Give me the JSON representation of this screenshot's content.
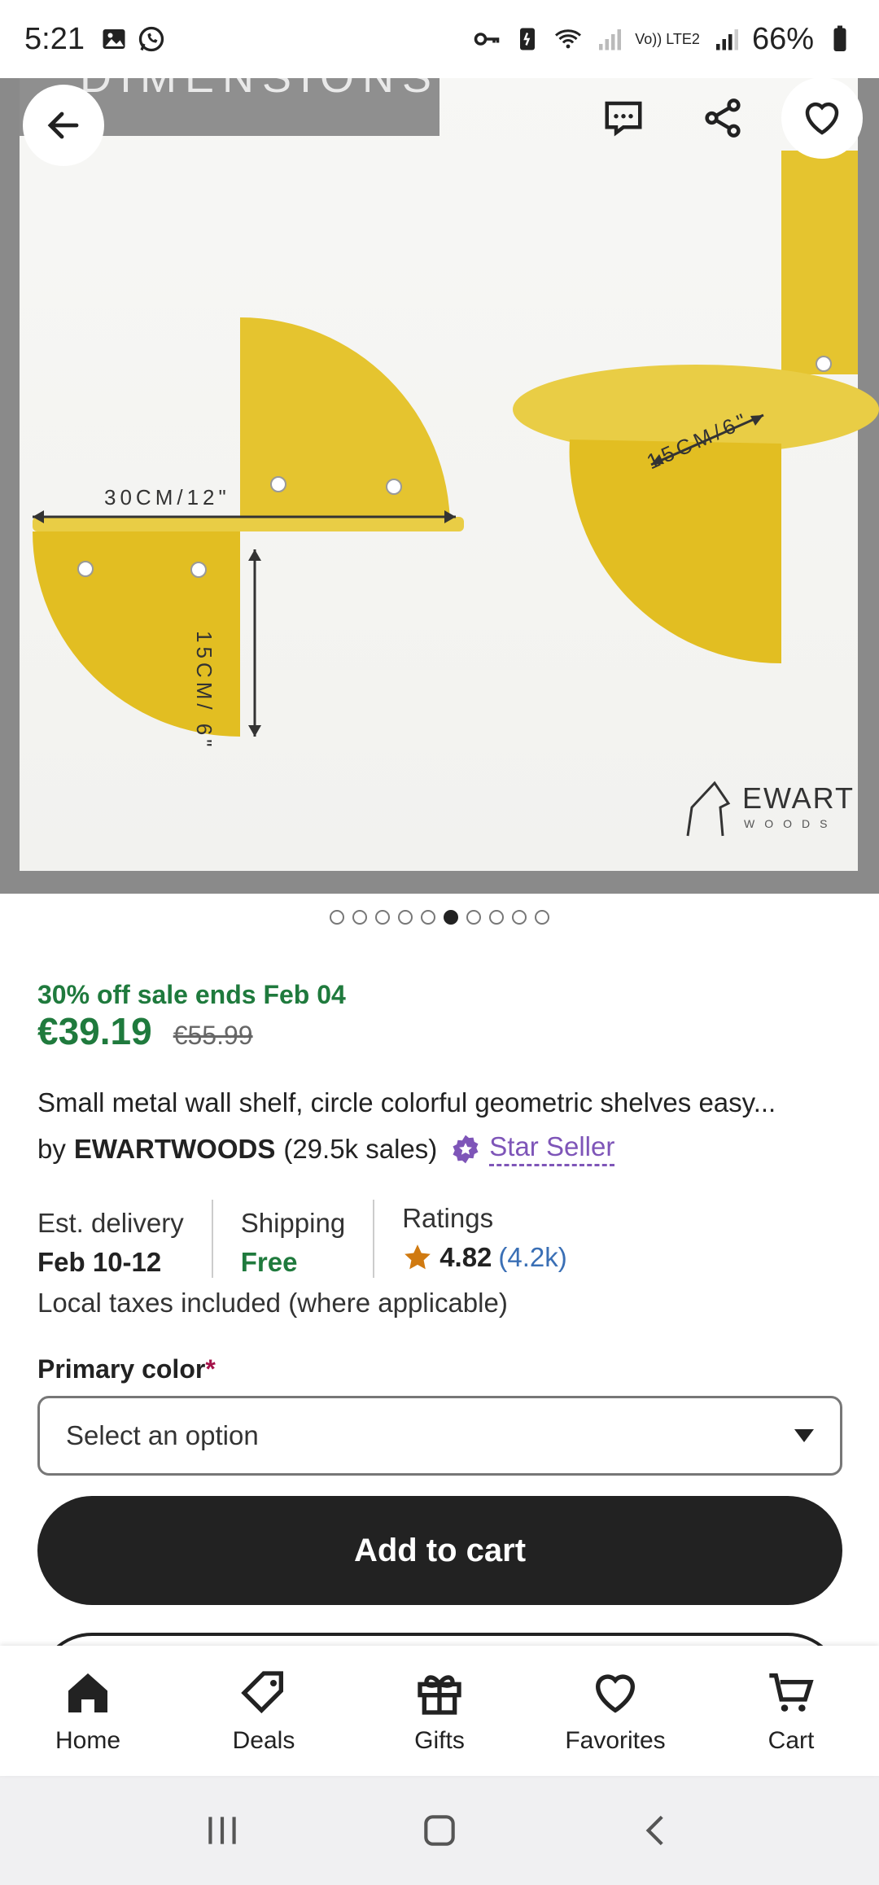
{
  "status_bar": {
    "time": "5:21",
    "battery": "66%",
    "network": "Vo)) LTE2"
  },
  "product_image": {
    "banner_text": "DIMENSIONS",
    "dim_width": "30CM/12\"",
    "dim_height": "15CM/ 6\"",
    "dim_depth": "15CM/6\"",
    "brand_logo": "EWART",
    "brand_sub": "WOODS",
    "carousel": {
      "count": 10,
      "active_index": 5
    }
  },
  "sale": {
    "text": "30% off sale ends Feb 04",
    "price": "€39.19",
    "original_price": "€55.99"
  },
  "product": {
    "title": "Small metal wall shelf, circle colorful geometric shelves easy...",
    "by": "by",
    "shop": "EWARTWOODS",
    "sales": "(29.5k sales)",
    "badge": "Star Seller"
  },
  "info": {
    "delivery_label": "Est. delivery",
    "delivery_value": "Feb 10-12",
    "shipping_label": "Shipping",
    "shipping_value": "Free",
    "ratings_label": "Ratings",
    "rating_value": "4.82",
    "rating_count": "(4.2k)",
    "taxes": "Local taxes included (where applicable)"
  },
  "options": {
    "label": "Primary color",
    "required_mark": "*",
    "select_value": "Select an option"
  },
  "actions": {
    "add_to_cart": "Add to cart"
  },
  "bottom_nav": [
    {
      "label": "Home",
      "icon": "home-icon"
    },
    {
      "label": "Deals",
      "icon": "tag-icon"
    },
    {
      "label": "Gifts",
      "icon": "gift-icon"
    },
    {
      "label": "Favorites",
      "icon": "heart-icon"
    },
    {
      "label": "Cart",
      "icon": "cart-icon"
    }
  ],
  "colors": {
    "sale_green": "#1f7a3d",
    "star_seller_purple": "#7e55b8",
    "shelf_yellow": "#e5c42f",
    "rating_star": "#d07a10",
    "button_dark": "#222222"
  }
}
